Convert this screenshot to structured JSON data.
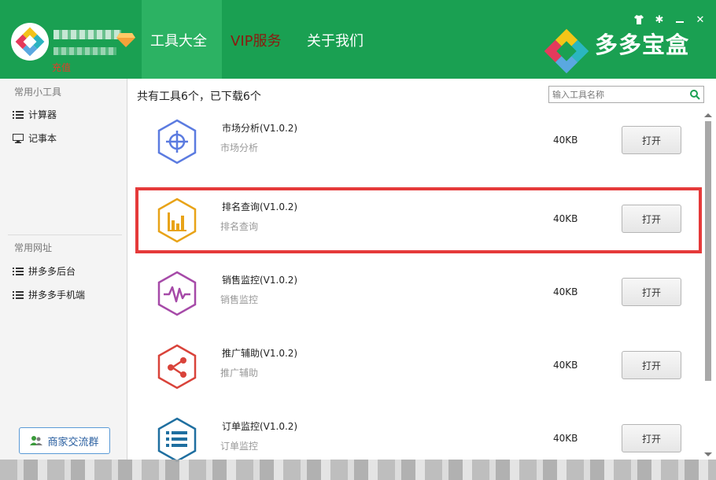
{
  "header": {
    "recharge_label": "充值",
    "nav": [
      {
        "label": "工具大全",
        "active": true
      },
      {
        "label": "VIP服务",
        "active": false
      },
      {
        "label": "关于我们",
        "active": false
      }
    ],
    "brand": "多多宝盒",
    "window_buttons": [
      "shirt-icon",
      "gear-icon",
      "minimize-icon",
      "close-icon"
    ],
    "colors": {
      "bar": "#1aa052",
      "active_tab": "#2cb263",
      "vip": "#8b1a0f"
    }
  },
  "sidebar": {
    "tools_title": "常用小工具",
    "tools": [
      {
        "label": "计算器",
        "icon": "list-icon"
      },
      {
        "label": "记事本",
        "icon": "monitor-icon"
      }
    ],
    "links_title": "常用网址",
    "links": [
      {
        "label": "拼多多后台",
        "icon": "list-icon"
      },
      {
        "label": "拼多多手机端",
        "icon": "list-icon"
      }
    ],
    "group_button": "商家交流群"
  },
  "main": {
    "summary": "共有工具6个，已下载6个",
    "search_placeholder": "输入工具名称",
    "tools": [
      {
        "name": "市场分析(V1.0.2)",
        "desc": "市场分析",
        "size": "40KB",
        "button": "打开",
        "icon": "target-icon",
        "color": "#5b7be0"
      },
      {
        "name": "排名查询(V1.0.2)",
        "desc": "排名查询",
        "size": "40KB",
        "button": "打开",
        "icon": "bar-chart-icon",
        "color": "#e8a318",
        "selected": true
      },
      {
        "name": "销售监控(V1.0.2)",
        "desc": "销售监控",
        "size": "40KB",
        "button": "打开",
        "icon": "pulse-icon",
        "color": "#a64aa8"
      },
      {
        "name": "推广辅助(V1.0.2)",
        "desc": "推广辅助",
        "size": "40KB",
        "button": "打开",
        "icon": "share-icon",
        "color": "#d9433a"
      },
      {
        "name": "订单监控(V1.0.2)",
        "desc": "订单监控",
        "size": "40KB",
        "button": "打开",
        "icon": "list-icon",
        "color": "#1f6fa0"
      }
    ]
  }
}
